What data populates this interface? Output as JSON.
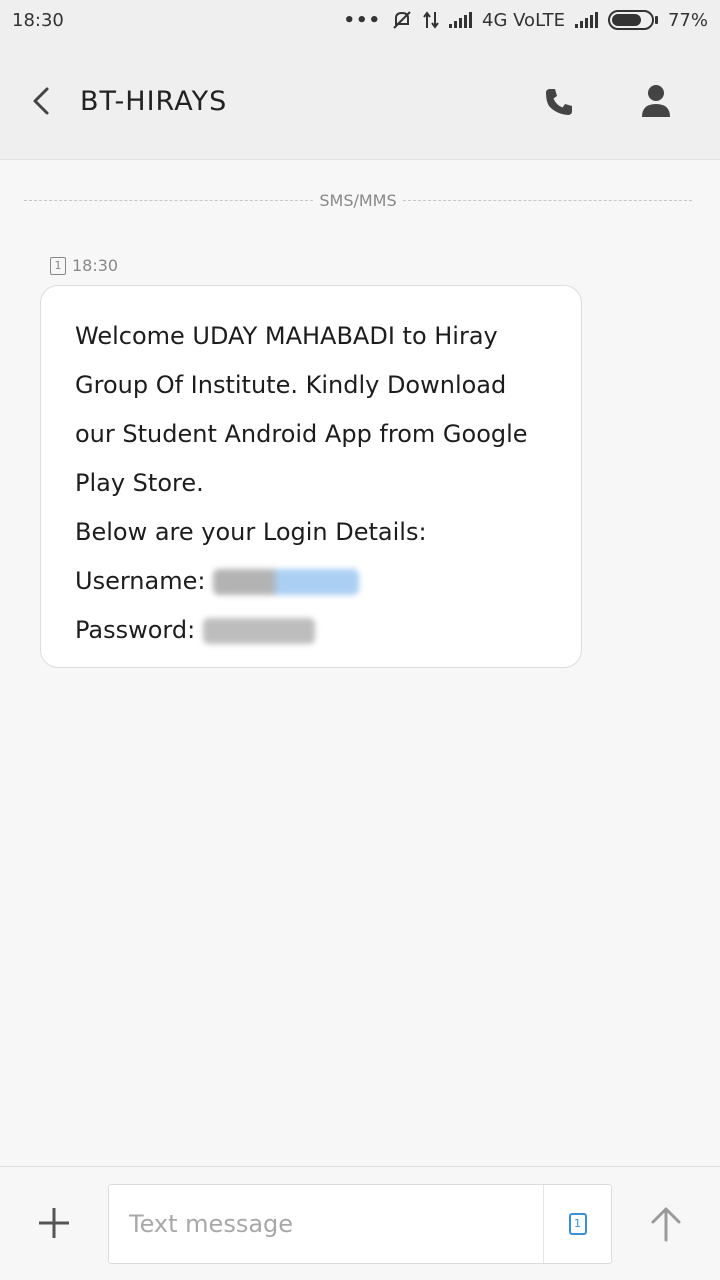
{
  "status_bar": {
    "time": "18:30",
    "more": "•••",
    "network": "4G VoLTE",
    "battery_percent": "77%",
    "battery_level": 0.77
  },
  "header": {
    "title": "BT-HIRAYS"
  },
  "thread": {
    "divider_label": "SMS/MMS",
    "sim_slot": "1",
    "message_time": "18:30",
    "message_lines": [
      "Welcome UDAY MAHABADI to Hiray",
      "Group Of Institute. Kindly Download",
      "our Student Android App from Google",
      "Play Store.",
      "Below are your Login Details:",
      "Username:",
      "Password:"
    ]
  },
  "composer": {
    "placeholder": "Text message",
    "sim_slot": "1"
  },
  "colors": {
    "background": "#f7f7f7",
    "header": "#efefef",
    "bubble": "#ffffff",
    "sim_accent": "#3b8fd6"
  },
  "icons": [
    "back-icon",
    "call-icon",
    "contact-icon",
    "sim-icon",
    "plus-icon",
    "send-icon",
    "signal-icon",
    "battery-icon",
    "mute-icon",
    "data-arrows-icon"
  ]
}
